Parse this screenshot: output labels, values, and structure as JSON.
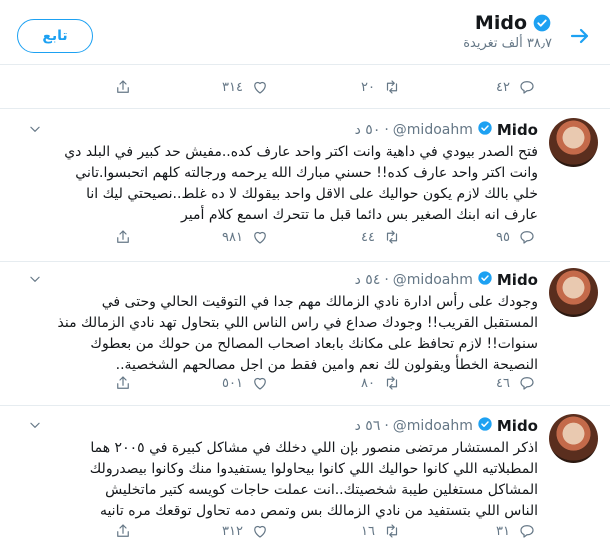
{
  "header": {
    "name": "Mido",
    "tweet_count": "٣٨٫٧ ألف تغريدة",
    "follow_label": "تابع"
  },
  "previous_tweet": {
    "replies": "٤٢",
    "retweets": "٢٠",
    "likes": "٣١٤"
  },
  "tweets": [
    {
      "name": "Mido",
      "handle": "@midoahm",
      "time": "٥٠ د",
      "lines": [
        "فتح الصدر بيودي في داهية وانت اكتر واحد عارف كده..مفيش حد كبير في البلد دي",
        "وانت اكتر واحد عارف كده!! حسني مبارك الله يرحمه ورجالته كلهم اتحبسوا.تاني",
        "خلي بالك لازم يكون حواليك على الاقل واحد بيقولك لا ده غلط..نصيحتي ليك انا",
        "عارف انه ابنك الصغير بس دائما قبل ما تتحرك اسمع كلام أمير"
      ],
      "replies": "٩٥",
      "retweets": "٤٤",
      "likes": "٩٨١"
    },
    {
      "name": "Mido",
      "handle": "@midoahm",
      "time": "٥٤ د",
      "lines": [
        "وجودك على رأس ادارة نادي الزمالك مهم جدا في التوقيت الحالي وحتى في",
        "المستقبل القريب!! وجودك صداع في راس الناس اللي بتحاول تهد نادي الزمالك منذ",
        "سنوات!! لازم تحافظ على مكانك بابعاد اصحاب المصالح من حولك من بعطوك",
        "النصيحة الخطأ ويقولون لك نعم وامين فقط من اجل مصالحهم الشخصية.."
      ],
      "replies": "٤٦",
      "retweets": "٨٠",
      "likes": "٥٠١"
    },
    {
      "name": "Mido",
      "handle": "@midoahm",
      "time": "٥٦ د",
      "lines": [
        "اذكر المستشار مرتضى منصور بإن اللي دخلك في مشاكل كبيرة في ٢٠٠٥ هما",
        "المطبلاتيه اللي كانوا حواليك اللي كانوا بيحاولوا يستفيدوا منك وكانوا بيصدرولك",
        "المشاكل مستغلين طيبة شخصيتك..انت عملت حاجات كويسه كتير ماتخليش",
        "الناس اللي بتستفيد من نادي الزمالك بس وتمص دمه تحاول توقعك مره تانيه"
      ],
      "replies": "٣١",
      "retweets": "١٦",
      "likes": "٣١٢"
    }
  ],
  "colors": {
    "accent": "#1da1f2",
    "text": "#14171a",
    "secondary": "#657786",
    "border": "#e6ecf0"
  },
  "icons": [
    "back-arrow-icon",
    "verified-icon",
    "caret-down-icon",
    "reply-icon",
    "retweet-icon",
    "like-icon",
    "share-icon"
  ]
}
